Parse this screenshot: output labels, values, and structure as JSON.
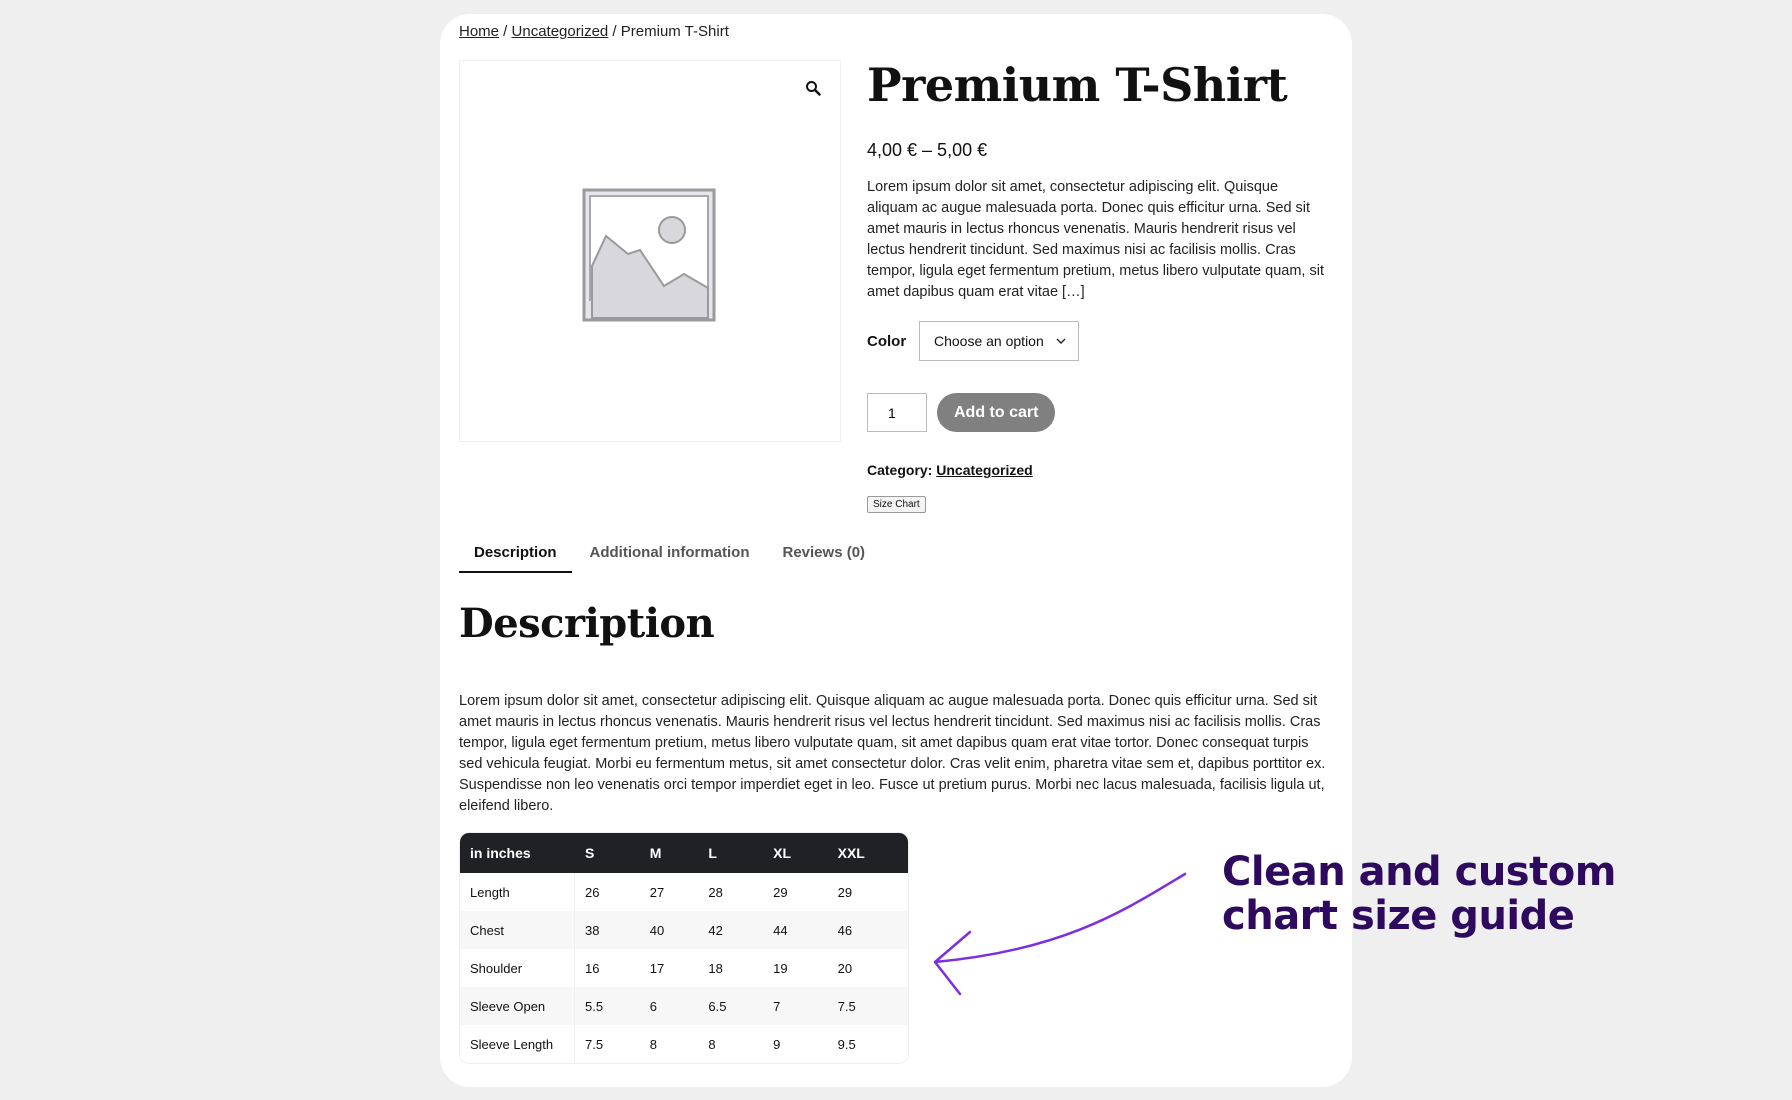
{
  "breadcrumb": {
    "home": "Home",
    "sep1": " / ",
    "category": "Uncategorized",
    "sep2": " / ",
    "current": "Premium T-Shirt"
  },
  "product": {
    "title": "Premium T-Shirt",
    "price": "4,00 € – 5,00 €",
    "short_description": "Lorem ipsum dolor sit amet, consectetur adipiscing elit. Quisque aliquam ac augue malesuada porta. Donec quis efficitur urna. Sed sit amet mauris in lectus rhoncus venenatis. Mauris hendrerit risus vel lectus hendrerit tincidunt. Sed maximus nisi ac facilisis mollis. Cras tempor, ligula eget fermentum pretium, metus libero vulputate quam, sit amet dapibus quam erat vitae […]",
    "variation_label": "Color",
    "variation_placeholder": "Choose an option",
    "quantity": "1",
    "add_to_cart": "Add to cart",
    "category_label": "Category:",
    "category_value": "Uncategorized",
    "size_chart_button": "Size Chart"
  },
  "tabs": [
    {
      "label": "Description",
      "active": true
    },
    {
      "label": "Additional information",
      "active": false
    },
    {
      "label": "Reviews (0)",
      "active": false
    }
  ],
  "description": {
    "heading": "Description",
    "body": "Lorem ipsum dolor sit amet, consectetur adipiscing elit. Quisque aliquam ac augue malesuada porta. Donec quis efficitur urna. Sed sit amet mauris in lectus rhoncus venenatis. Mauris hendrerit risus vel lectus hendrerit tincidunt. Sed maximus nisi ac facilisis mollis. Cras tempor, ligula eget fermentum pretium, metus libero vulputate quam, sit amet dapibus quam erat vitae tortor. Donec consequat turpis sed vehicula feugiat. Morbi eu fermentum metus, sit amet consectetur dolor. Cras velit enim, pharetra vitae sem et, dapibus porttitor ex. Suspendisse non leo venenatis orci tempor imperdiet eget in leo. Fusce ut pretium purus. Morbi nec lacus malesuada, facilisis ligula ut, eleifend libero."
  },
  "size_table": {
    "headers": [
      "in inches",
      "S",
      "M",
      "L",
      "XL",
      "XXL"
    ],
    "rows": [
      [
        "Length",
        "26",
        "27",
        "28",
        "29",
        "29"
      ],
      [
        "Chest",
        "38",
        "40",
        "42",
        "44",
        "46"
      ],
      [
        "Shoulder",
        "16",
        "17",
        "18",
        "19",
        "20"
      ],
      [
        "Sleeve Open",
        "5.5",
        "6",
        "6.5",
        "7",
        "7.5"
      ],
      [
        "Sleeve Length",
        "7.5",
        "8",
        "8",
        "9",
        "9.5"
      ]
    ]
  },
  "callout": {
    "line1": "Clean and custom",
    "line2": "chart size guide"
  },
  "icons": {
    "zoom": "magnifier-icon",
    "placeholder": "image-placeholder-icon",
    "dropdown": "chevron-down-icon",
    "arrow": "curved-arrow-icon"
  },
  "colors": {
    "callout": "#2e0a5e",
    "arrow": "#7b2fe0",
    "table_header": "#1f2124",
    "button": "#808080"
  }
}
